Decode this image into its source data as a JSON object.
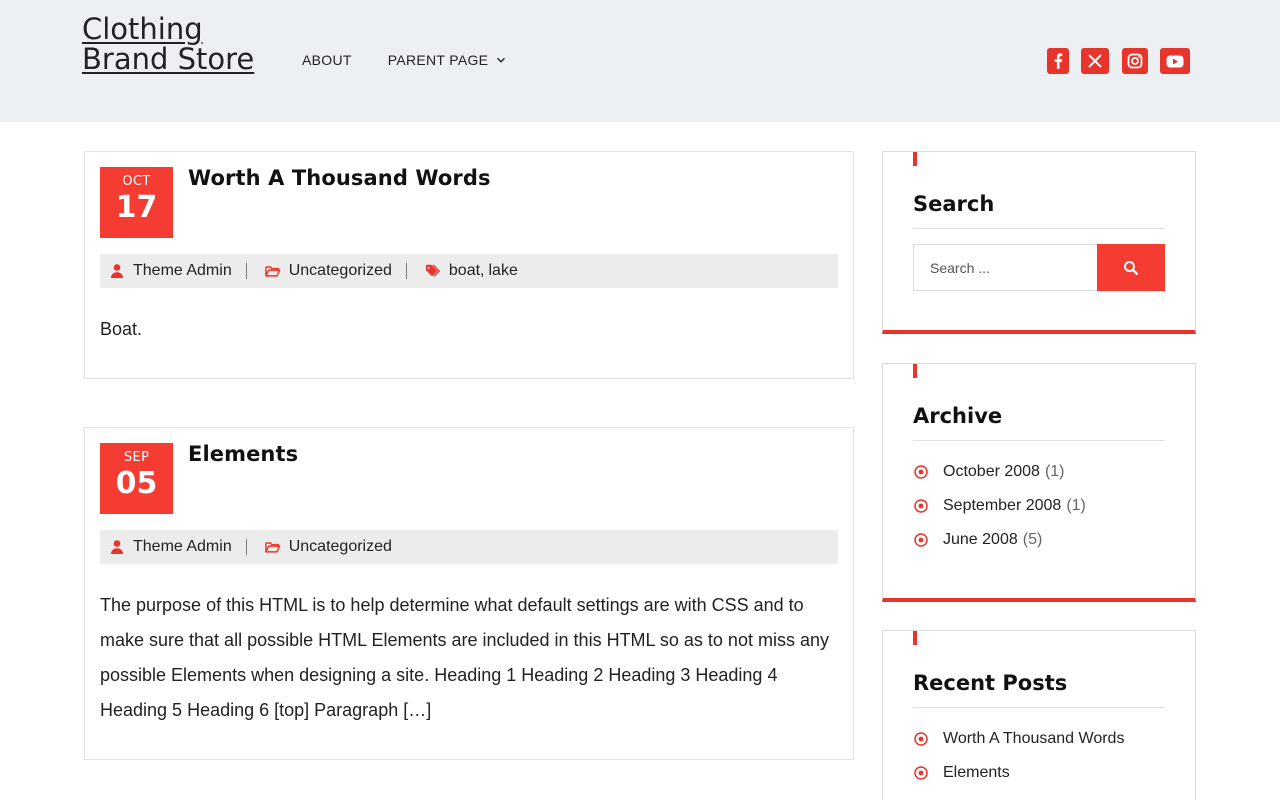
{
  "site": {
    "title": "Clothing Brand Store"
  },
  "nav": {
    "items": [
      {
        "label": "ABOUT"
      },
      {
        "label": "PARENT PAGE"
      }
    ]
  },
  "social": [
    {
      "icon": "facebook-icon"
    },
    {
      "icon": "x-twitter-icon"
    },
    {
      "icon": "instagram-icon"
    },
    {
      "icon": "youtube-icon"
    }
  ],
  "colors": {
    "accent": "#f43c33",
    "header_bg": "#edf0f2",
    "meta_bg": "#ececec"
  },
  "posts": [
    {
      "month": "OCT",
      "day": "17",
      "title": "Worth A Thousand Words",
      "author": "Theme Admin",
      "category": "Uncategorized",
      "tags": [
        "boat",
        "lake"
      ],
      "tag_sep": ",",
      "excerpt": "Boat."
    },
    {
      "month": "SEP",
      "day": "05",
      "title": "Elements",
      "author": "Theme Admin",
      "category": "Uncategorized",
      "excerpt": "The purpose of this HTML is to help determine what default settings are with CSS and to make sure that all possible HTML Elements are included in this HTML so as to not miss any possible Elements when designing a site. Heading 1 Heading 2 Heading 3 Heading 4 Heading 5 Heading 6 [top] Paragraph […]"
    }
  ],
  "sidebar": {
    "search": {
      "title": "Search",
      "placeholder": "Search ..."
    },
    "archive": {
      "title": "Archive",
      "items": [
        {
          "label": "October 2008",
          "count": "(1)"
        },
        {
          "label": "September 2008",
          "count": "(1)"
        },
        {
          "label": "June 2008",
          "count": "(5)"
        }
      ]
    },
    "recent": {
      "title": "Recent Posts",
      "items": [
        {
          "label": "Worth A Thousand Words"
        },
        {
          "label": "Elements"
        }
      ]
    }
  }
}
